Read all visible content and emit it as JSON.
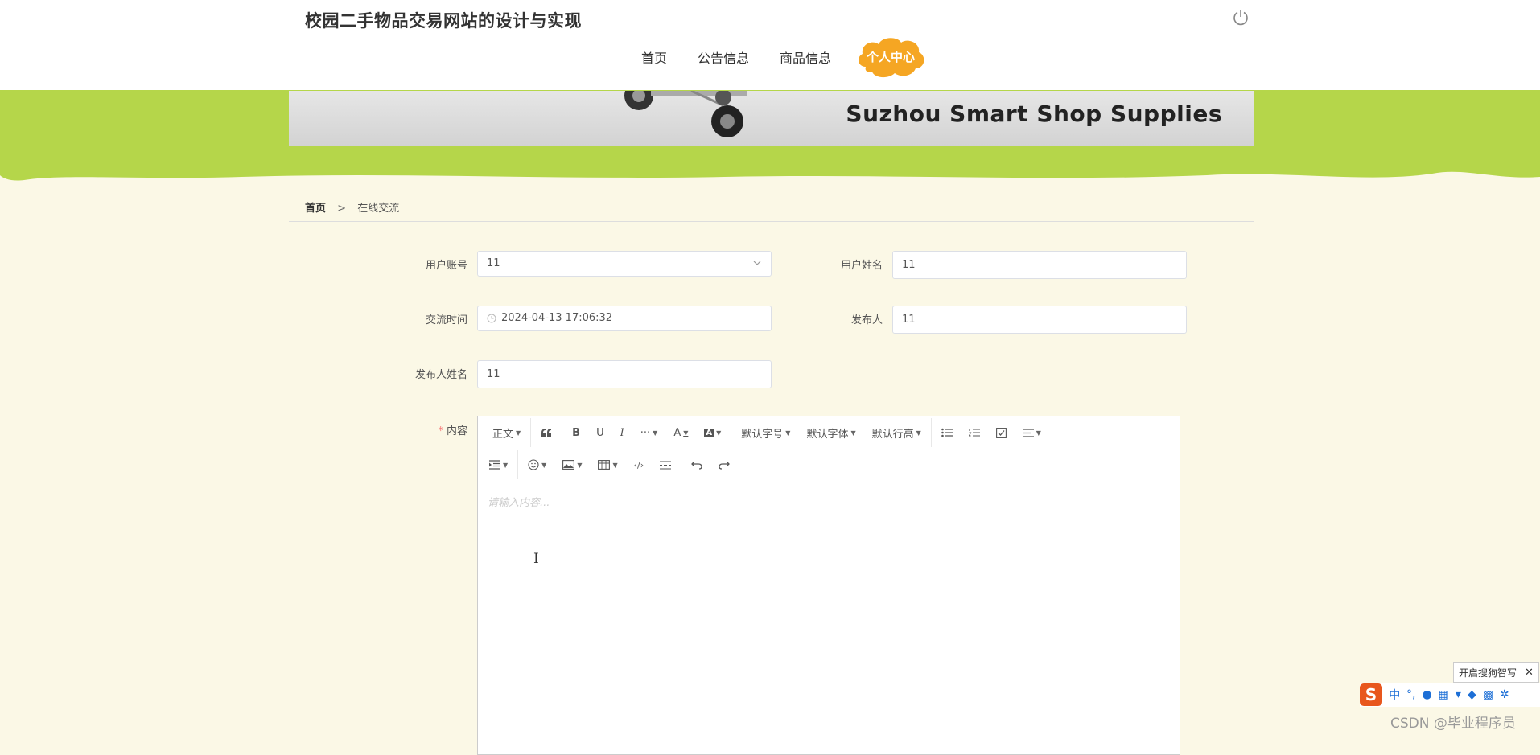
{
  "header": {
    "site_title": "校园二手物品交易网站的设计与实现",
    "nav": [
      {
        "label": "首页"
      },
      {
        "label": "公告信息"
      },
      {
        "label": "商品信息"
      },
      {
        "label": "个人中心"
      }
    ],
    "power_icon": "power-icon"
  },
  "banner": {
    "text": "Suzhou Smart Shop Supplies",
    "accent_color": "#b5d64a"
  },
  "breadcrumb": {
    "home": "首页",
    "separator": ">",
    "current": "在线交流"
  },
  "form": {
    "user_account": {
      "label": "用户账号",
      "value": "11"
    },
    "user_name": {
      "label": "用户姓名",
      "value": "11"
    },
    "exchange_time": {
      "label": "交流时间",
      "value": "2024-04-13 17:06:32"
    },
    "publisher": {
      "label": "发布人",
      "value": "11"
    },
    "publisher_name": {
      "label": "发布人姓名",
      "value": "11"
    },
    "content": {
      "label": "内容",
      "required_mark": "*",
      "placeholder": "请输入内容..."
    }
  },
  "editor_toolbar": {
    "row1": {
      "paragraph": "正文",
      "font_size": "默认字号",
      "font_family": "默认字体",
      "line_height": "默认行高"
    }
  },
  "ime": {
    "tip": "开启搜狗智写",
    "close": "✕",
    "lang": "中"
  },
  "watermark": "CSDN @毕业程序员",
  "colors": {
    "page_bg": "#fbf8e6",
    "nav_active": "#f5a623",
    "required": "#f56c6c"
  }
}
